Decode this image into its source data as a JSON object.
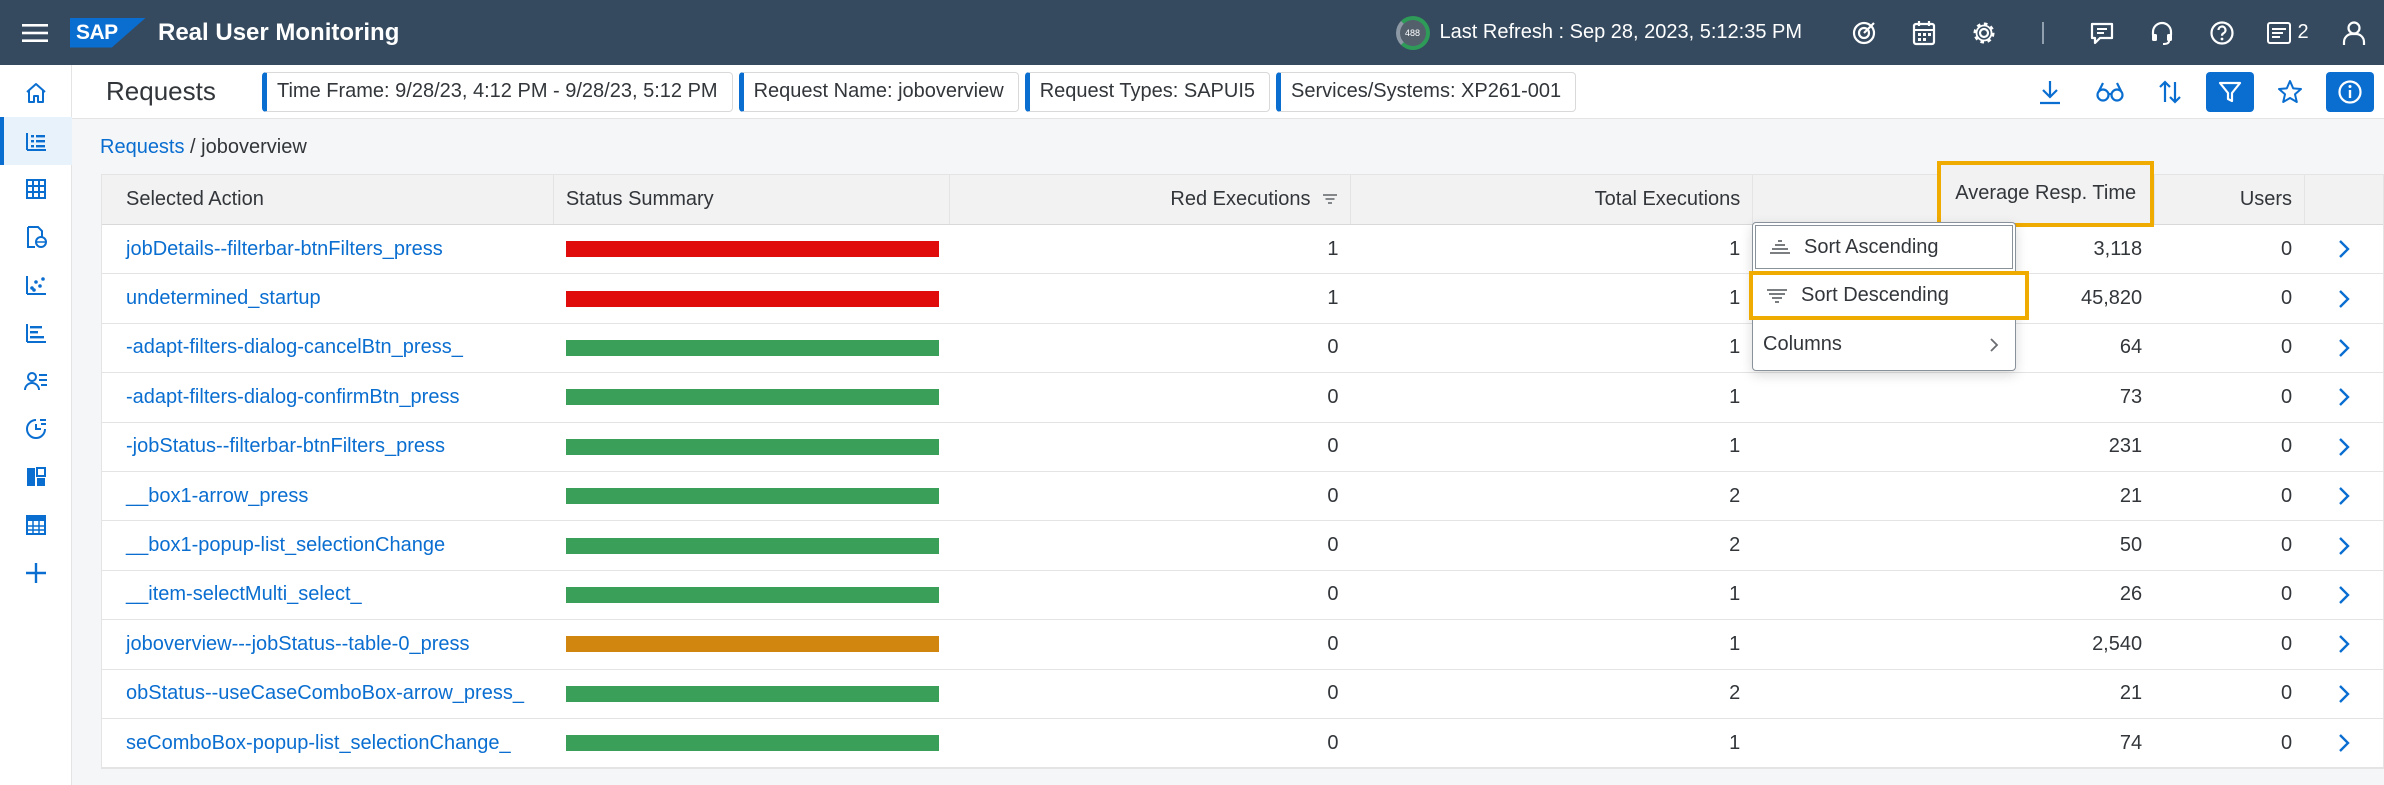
{
  "shell": {
    "app_title": "Real User Monitoring",
    "logo_text": "SAP",
    "refresh_badge": "488",
    "last_refresh": "Last Refresh : Sep 28, 2023, 5:12:35 PM",
    "notification_count": "2"
  },
  "header": {
    "title": "Requests",
    "filters": [
      "Time Frame: 9/28/23, 4:12 PM - 9/28/23, 5:12 PM",
      "Request Name: joboverview",
      "Request Types: SAPUI5",
      "Services/Systems: XP261-001"
    ]
  },
  "breadcrumb": {
    "parent": "Requests",
    "separator": " / ",
    "current": "joboverview"
  },
  "table": {
    "columns": {
      "action": "Selected Action",
      "status": "Status Summary",
      "red": "Red Executions",
      "total": "Total Executions",
      "avg": "Average Resp. Time",
      "users": "Users"
    },
    "rows": [
      {
        "action": "jobDetails--filterbar-btnFilters_press",
        "status": "red",
        "red": "1",
        "total": "1",
        "avg": "3,118",
        "users": "0"
      },
      {
        "action": "undetermined_startup",
        "status": "red",
        "red": "1",
        "total": "1",
        "avg": "45,820",
        "users": "0"
      },
      {
        "action": "-adapt-filters-dialog-cancelBtn_press_",
        "status": "green",
        "red": "0",
        "total": "1",
        "avg": "64",
        "users": "0"
      },
      {
        "action": "-adapt-filters-dialog-confirmBtn_press",
        "status": "green",
        "red": "0",
        "total": "1",
        "avg": "73",
        "users": "0"
      },
      {
        "action": "-jobStatus--filterbar-btnFilters_press",
        "status": "green",
        "red": "0",
        "total": "1",
        "avg": "231",
        "users": "0"
      },
      {
        "action": "__box1-arrow_press",
        "status": "green",
        "red": "0",
        "total": "2",
        "avg": "21",
        "users": "0"
      },
      {
        "action": "__box1-popup-list_selectionChange",
        "status": "green",
        "red": "0",
        "total": "2",
        "avg": "50",
        "users": "0"
      },
      {
        "action": "__item-selectMulti_select_",
        "status": "green",
        "red": "0",
        "total": "1",
        "avg": "26",
        "users": "0"
      },
      {
        "action": "joboverview---jobStatus--table-0_press",
        "status": "orange",
        "red": "0",
        "total": "1",
        "avg": "2,540",
        "users": "0"
      },
      {
        "action": "obStatus--useCaseComboBox-arrow_press_",
        "status": "green",
        "red": "0",
        "total": "2",
        "avg": "21",
        "users": "0"
      },
      {
        "action": "seComboBox-popup-list_selectionChange_",
        "status": "green",
        "red": "0",
        "total": "1",
        "avg": "74",
        "users": "0"
      }
    ]
  },
  "popover": {
    "sort_ascending": "Sort Ascending",
    "sort_descending": "Sort Descending",
    "columns": "Columns"
  },
  "colors": {
    "red": "#e00b0b",
    "green": "#3a9f58",
    "orange": "#d0860f",
    "accent": "#0a6ed1",
    "highlight": "#f0ab00"
  }
}
